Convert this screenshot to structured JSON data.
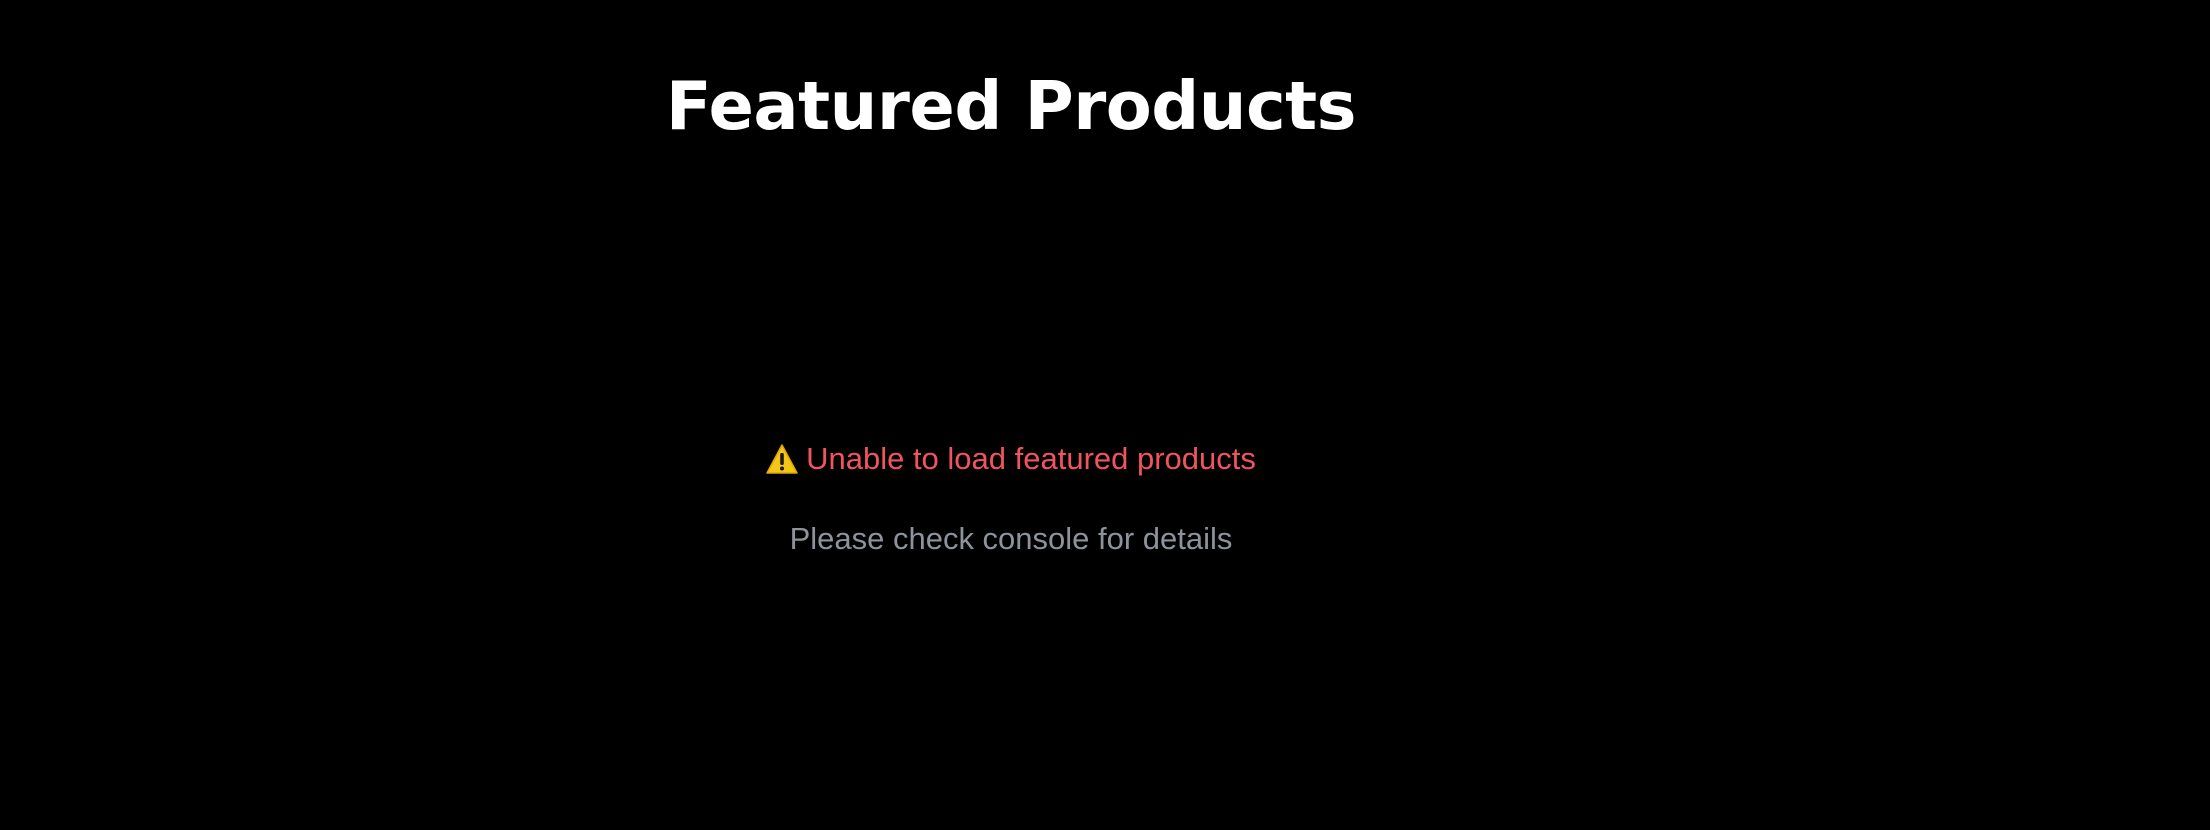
{
  "section": {
    "title": "Featured Products"
  },
  "error": {
    "icon": "warning-icon",
    "message": "Unable to load featured products",
    "hint": "Please check console for details"
  },
  "colors": {
    "background": "#000000",
    "title": "#ffffff",
    "error": "#f0545e",
    "hint": "#8d939c",
    "warning": "#f5c518"
  }
}
